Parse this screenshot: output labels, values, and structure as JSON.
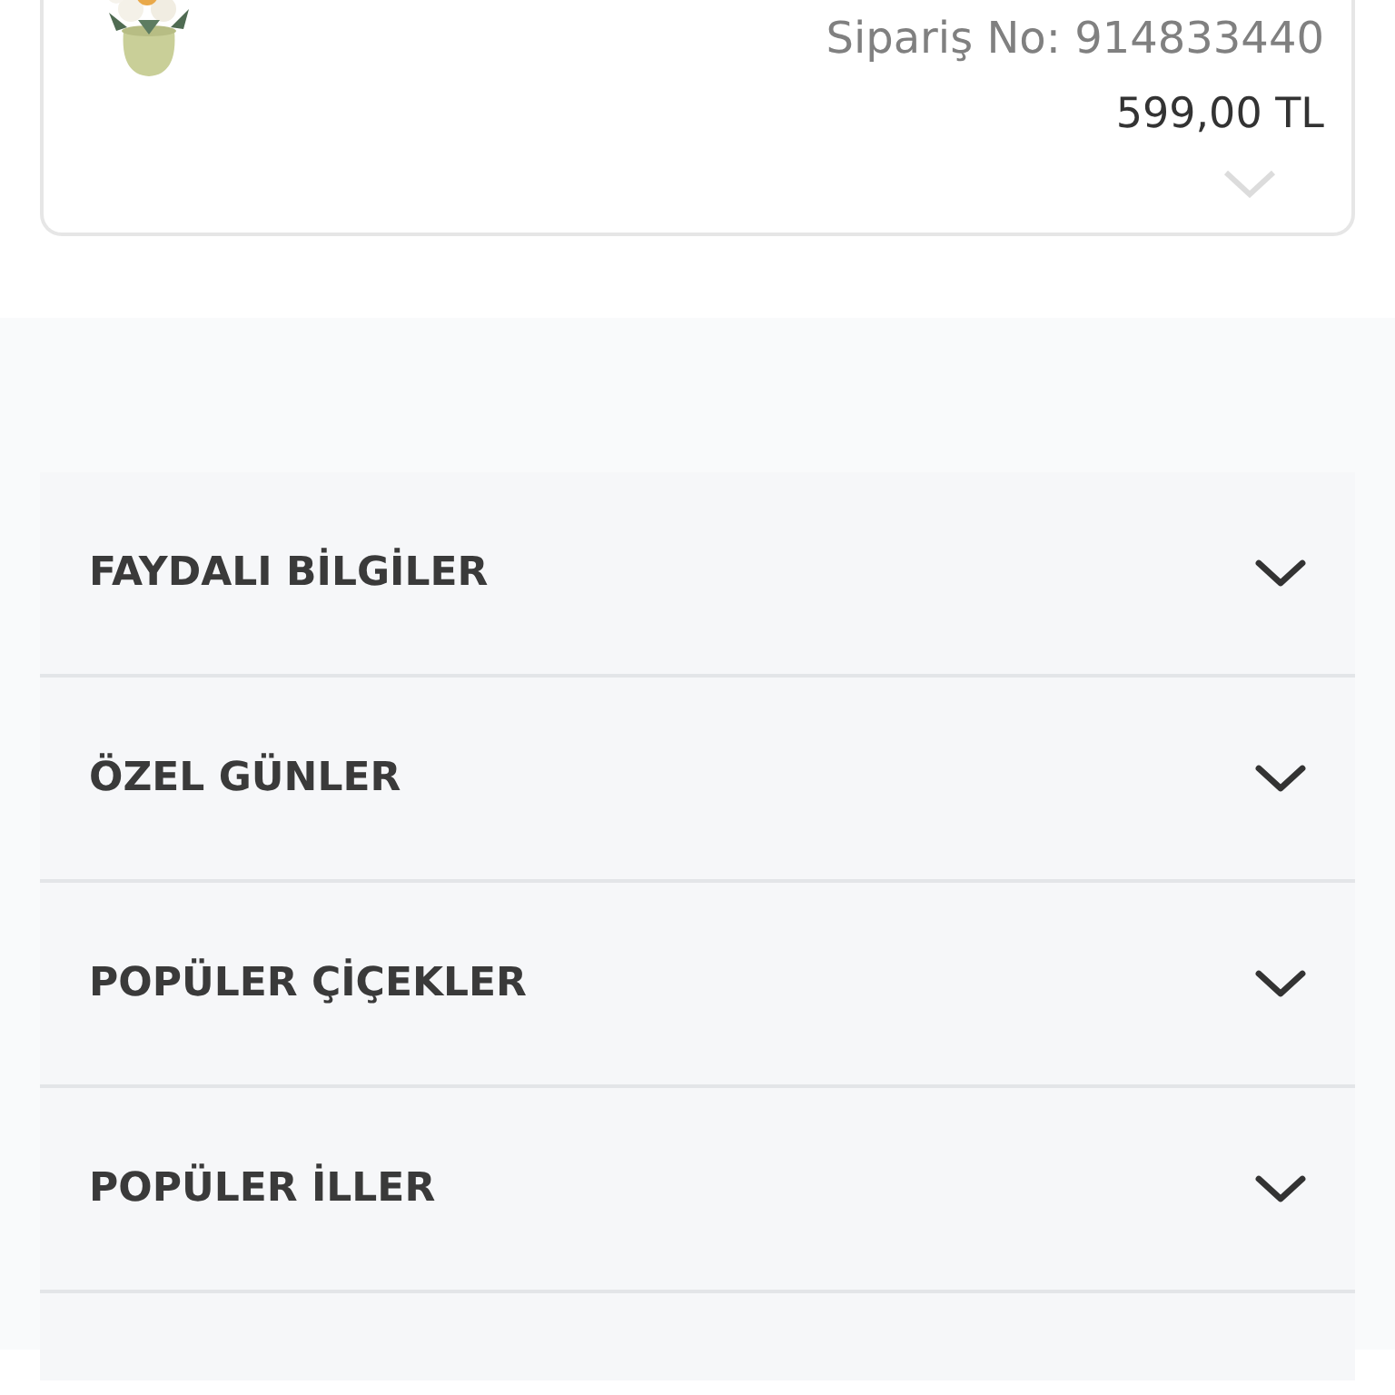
{
  "order": {
    "order_number": "Sipariş No: 914833440",
    "price": "599,00 TL",
    "expanded": false
  },
  "accordion": [
    {
      "label": "FAYDALI BİLGİLER",
      "expanded": false
    },
    {
      "label": "ÖZEL GÜNLER",
      "expanded": false
    },
    {
      "label": "POPÜLER ÇİÇEKLER",
      "expanded": false
    },
    {
      "label": "POPÜLER İLLER",
      "expanded": false
    }
  ]
}
